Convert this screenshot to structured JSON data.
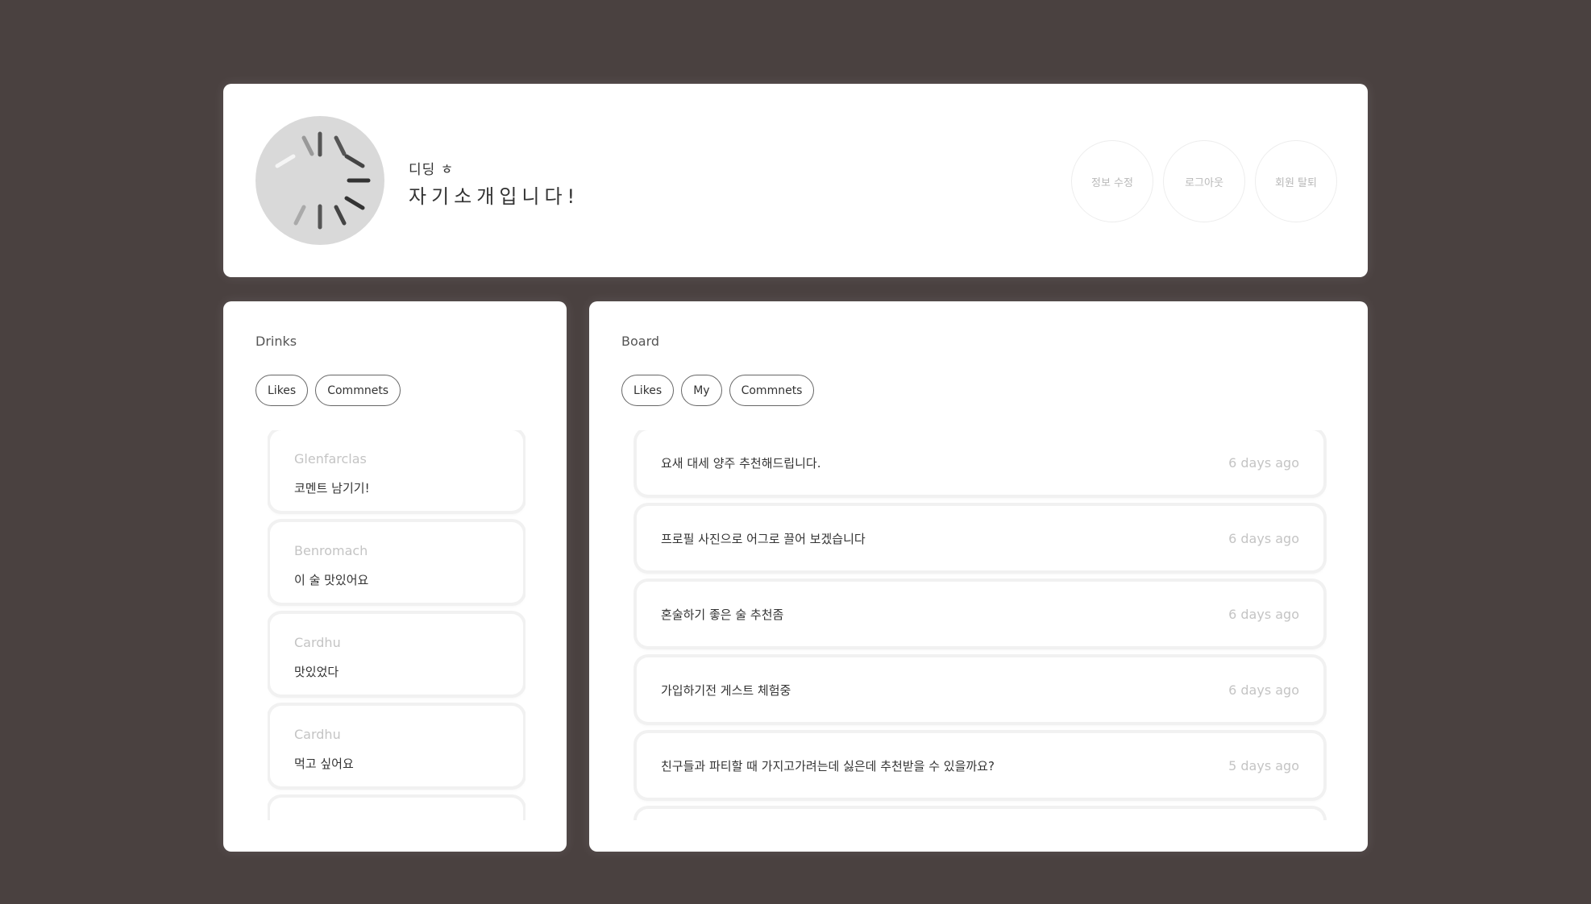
{
  "profile": {
    "nickname": "디딩 ㅎ",
    "intro": "자기소개입니다!",
    "buttons": {
      "edit": "정보 수정",
      "logout": "로그아웃",
      "withdraw": "회원 탈퇴"
    }
  },
  "drinks": {
    "title": "Drinks",
    "tabs": [
      "Likes",
      "Commnets"
    ],
    "items": [
      {
        "name": "Glenfarclas",
        "comment": "코멘트 남기기!"
      },
      {
        "name": "Benromach",
        "comment": "이 술 맛있어요"
      },
      {
        "name": "Cardhu",
        "comment": "맛있었다"
      },
      {
        "name": "Cardhu",
        "comment": "먹고 싶어요"
      }
    ]
  },
  "board": {
    "title": "Board",
    "tabs": [
      "Likes",
      "My",
      "Commnets"
    ],
    "posts": [
      {
        "title": "요새 대세 양주 추천해드립니다.",
        "time": "6 days ago"
      },
      {
        "title": "프로필 사진으로 어그로 끌어 보겠습니다",
        "time": "6 days ago"
      },
      {
        "title": "혼술하기 좋은 술 추천좀",
        "time": "6 days ago"
      },
      {
        "title": "가입하기전 게스트 체험중",
        "time": "6 days ago"
      },
      {
        "title": "친구들과 파티할 때 가지고가려는데 싫은데 추천받을 수 있을까요?",
        "time": "5 days ago"
      }
    ]
  },
  "colors": {
    "background": "#4a4140",
    "card": "#ffffff",
    "muted_text": "#c4c4c4"
  }
}
